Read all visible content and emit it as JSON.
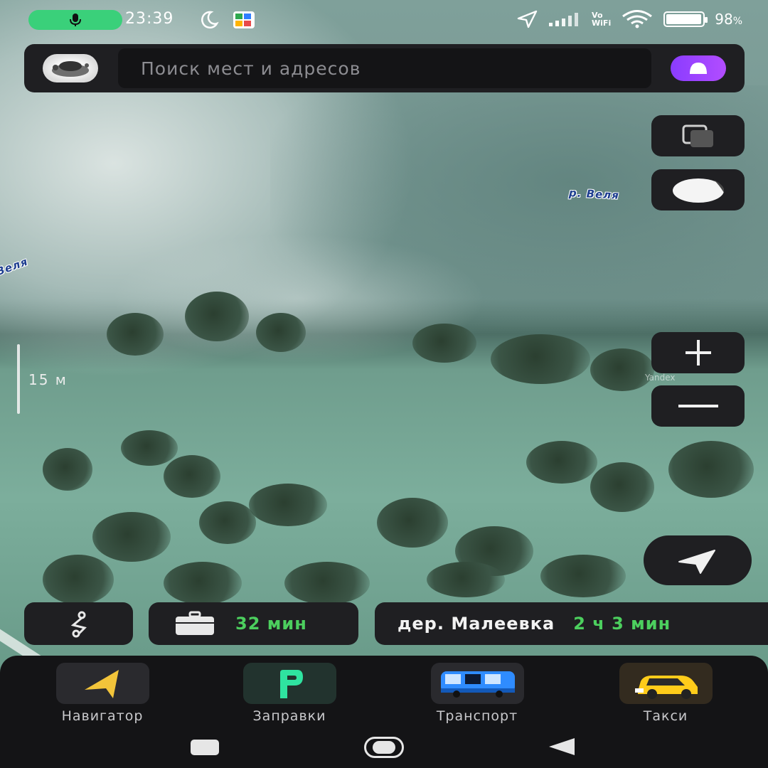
{
  "status_bar": {
    "time": "23:39",
    "battery_percent": "98",
    "battery_suffix": "%",
    "battery_level": 0.98,
    "vowifi_line1": "Vo",
    "vowifi_line2": "WiFi",
    "icons": [
      "mic-icon",
      "moon-icon",
      "app-notification-icon",
      "location-arrow-icon",
      "signal-icon",
      "vowifi-icon",
      "wifi-icon",
      "battery-icon"
    ]
  },
  "search": {
    "placeholder": "Поиск мест и адресов"
  },
  "map": {
    "labels": {
      "river_right": "р. Веля",
      "river_left": "Веля"
    },
    "scale_label": "15 м",
    "watermark": "Yandex"
  },
  "controls": {
    "zoom_in": "+",
    "zoom_out": "—",
    "icons": [
      "layers-icon",
      "night-mode-icon",
      "plus-icon",
      "minus-icon",
      "location-arrow-icon"
    ]
  },
  "route_chips": [
    {
      "icon": "route-icon"
    },
    {
      "icon": "briefcase-icon",
      "time": "32 мин"
    },
    {
      "place": "дер. Малеевка",
      "time": "2 ч 3 мин"
    }
  ],
  "apps": [
    {
      "label": "Навигатор",
      "icon": "navigator-arrow-icon"
    },
    {
      "label": "Заправки",
      "icon": "fuel-p-icon"
    },
    {
      "label": "Транспорт",
      "icon": "bus-icon"
    },
    {
      "label": "Такси",
      "icon": "taxi-car-icon"
    }
  ],
  "colors": {
    "accent_green": "#4ccf5e",
    "mic_green": "#3ad07a",
    "alice_purple": "#9a3cff",
    "panel_dark": "#1f1f22",
    "navigator_yellow": "#f2c43a",
    "fuel_green": "#2fe3a0",
    "bus_blue": "#2f8cff",
    "taxi_yellow": "#ffcc1a"
  }
}
